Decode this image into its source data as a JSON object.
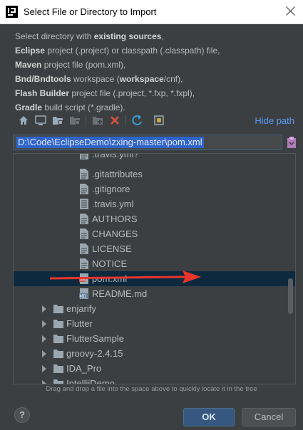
{
  "window": {
    "title": "Select File or Directory to Import"
  },
  "description": {
    "lines": [
      {
        "pre": "Select directory with ",
        "bold": "existing sources",
        "post": ","
      },
      {
        "pre": "",
        "bold": "Eclipse",
        "post": " project (.project) or classpath (.classpath) file,"
      },
      {
        "pre": "",
        "bold": "Maven",
        "post": " project file (pom.xml),"
      },
      {
        "pre": "",
        "bold": "Bnd/Bndtools",
        "post": " workspace (",
        "bold2": "workspace",
        "post2": "/cnf),"
      },
      {
        "pre": "",
        "bold": "Flash Builder",
        "post": " project file (.project, *.fxp, *.fxpl),"
      },
      {
        "pre": "",
        "bold": "Gradle",
        "post": " build script (*.gradle)."
      }
    ]
  },
  "toolbar": {
    "icons": [
      "home-icon",
      "desktop-icon",
      "project-folder-icon",
      "module-folder-icon",
      "new-folder-icon",
      "delete-icon",
      "refresh-icon",
      "show-hidden-icon"
    ],
    "hide_path_label": "Hide path"
  },
  "path": {
    "value": "D:\\Code\\EclipseDemo\\zxing-master\\pom.xml"
  },
  "tree": {
    "rows": [
      {
        "label": ".travis.yml?",
        "type": "file-partial"
      },
      {
        "label": ".gitattributes",
        "type": "file"
      },
      {
        "label": ".gitignore",
        "type": "file"
      },
      {
        "label": ".travis.yml",
        "type": "yml"
      },
      {
        "label": "AUTHORS",
        "type": "file"
      },
      {
        "label": "CHANGES",
        "type": "file"
      },
      {
        "label": "LICENSE",
        "type": "file"
      },
      {
        "label": "NOTICE",
        "type": "file"
      },
      {
        "label": "pom.xml",
        "type": "xml",
        "selected": true
      },
      {
        "label": "README.md",
        "type": "md"
      },
      {
        "label": "enjarify",
        "type": "folder"
      },
      {
        "label": "Flutter",
        "type": "folder"
      },
      {
        "label": "FlutterSample",
        "type": "folder"
      },
      {
        "label": "groovy-2.4.15",
        "type": "folder"
      },
      {
        "label": "IDA_Pro",
        "type": "folder"
      },
      {
        "label": "IntellijDemo",
        "type": "folder"
      }
    ]
  },
  "hint": "Drag and drop a file into the space above to quickly locate it in the tree",
  "buttons": {
    "help": "?",
    "ok": "OK",
    "cancel": "Cancel"
  },
  "colors": {
    "link": "#589df6",
    "selection": "#0d293e",
    "annotation_arrow": "#e8352b"
  }
}
